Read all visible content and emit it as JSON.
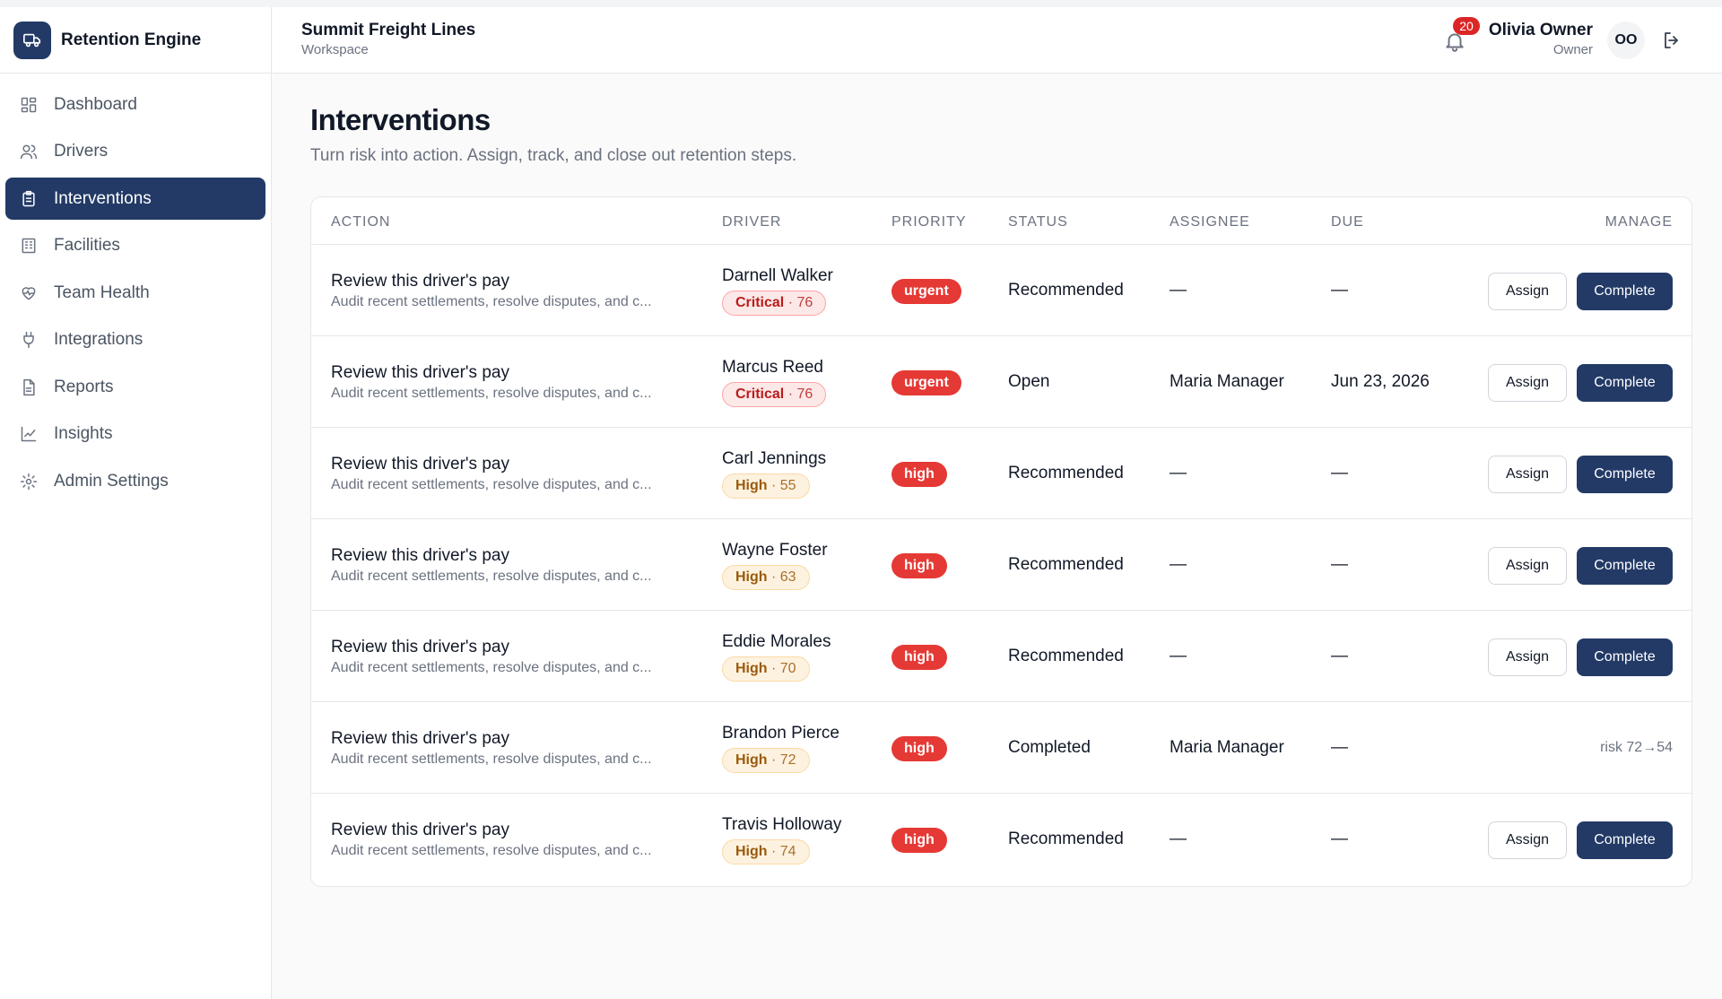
{
  "app": {
    "name": "Retention Engine"
  },
  "sidebar": {
    "items": [
      {
        "label": "Dashboard",
        "icon": "dashboard-icon",
        "active": false
      },
      {
        "label": "Drivers",
        "icon": "users-icon",
        "active": false
      },
      {
        "label": "Interventions",
        "icon": "clipboard-icon",
        "active": true
      },
      {
        "label": "Facilities",
        "icon": "building-icon",
        "active": false
      },
      {
        "label": "Team Health",
        "icon": "heart-pulse-icon",
        "active": false
      },
      {
        "label": "Integrations",
        "icon": "plug-icon",
        "active": false
      },
      {
        "label": "Reports",
        "icon": "file-icon",
        "active": false
      },
      {
        "label": "Insights",
        "icon": "chart-line-icon",
        "active": false
      },
      {
        "label": "Admin Settings",
        "icon": "gear-icon",
        "active": false
      }
    ]
  },
  "header": {
    "workspace_name": "Summit Freight Lines",
    "workspace_label": "Workspace",
    "notifications_count": "20",
    "user_name": "Olivia Owner",
    "user_role": "Owner",
    "user_initials": "OO"
  },
  "page": {
    "title": "Interventions",
    "subtitle": "Turn risk into action. Assign, track, and close out retention steps."
  },
  "table": {
    "headers": {
      "action": "ACTION",
      "driver": "DRIVER",
      "priority": "PRIORITY",
      "status": "STATUS",
      "assignee": "ASSIGNEE",
      "due": "DUE",
      "manage": "MANAGE"
    },
    "assign_label": "Assign",
    "complete_label": "Complete",
    "rows": [
      {
        "action": "Review this driver's pay",
        "description": "Audit recent settlements, resolve disputes, and c...",
        "driver": "Darnell Walker",
        "risk_level": "Critical",
        "risk_score": "· 76",
        "priority": "urgent",
        "status": "Recommended",
        "assignee": "—",
        "due": "—",
        "risk_change": ""
      },
      {
        "action": "Review this driver's pay",
        "description": "Audit recent settlements, resolve disputes, and c...",
        "driver": "Marcus Reed",
        "risk_level": "Critical",
        "risk_score": "· 76",
        "priority": "urgent",
        "status": "Open",
        "assignee": "Maria Manager",
        "due": "Jun 23, 2026",
        "risk_change": ""
      },
      {
        "action": "Review this driver's pay",
        "description": "Audit recent settlements, resolve disputes, and c...",
        "driver": "Carl Jennings",
        "risk_level": "High",
        "risk_score": "· 55",
        "priority": "high",
        "status": "Recommended",
        "assignee": "—",
        "due": "—",
        "risk_change": ""
      },
      {
        "action": "Review this driver's pay",
        "description": "Audit recent settlements, resolve disputes, and c...",
        "driver": "Wayne Foster",
        "risk_level": "High",
        "risk_score": "· 63",
        "priority": "high",
        "status": "Recommended",
        "assignee": "—",
        "due": "—",
        "risk_change": ""
      },
      {
        "action": "Review this driver's pay",
        "description": "Audit recent settlements, resolve disputes, and c...",
        "driver": "Eddie Morales",
        "risk_level": "High",
        "risk_score": "· 70",
        "priority": "high",
        "status": "Recommended",
        "assignee": "—",
        "due": "—",
        "risk_change": ""
      },
      {
        "action": "Review this driver's pay",
        "description": "Audit recent settlements, resolve disputes, and c...",
        "driver": "Brandon Pierce",
        "risk_level": "High",
        "risk_score": "· 72",
        "priority": "high",
        "status": "Completed",
        "assignee": "Maria Manager",
        "due": "—",
        "risk_change": "risk 72→54"
      },
      {
        "action": "Review this driver's pay",
        "description": "Audit recent settlements, resolve disputes, and c...",
        "driver": "Travis Holloway",
        "risk_level": "High",
        "risk_score": "· 74",
        "priority": "high",
        "status": "Recommended",
        "assignee": "—",
        "due": "—",
        "risk_change": ""
      }
    ]
  }
}
